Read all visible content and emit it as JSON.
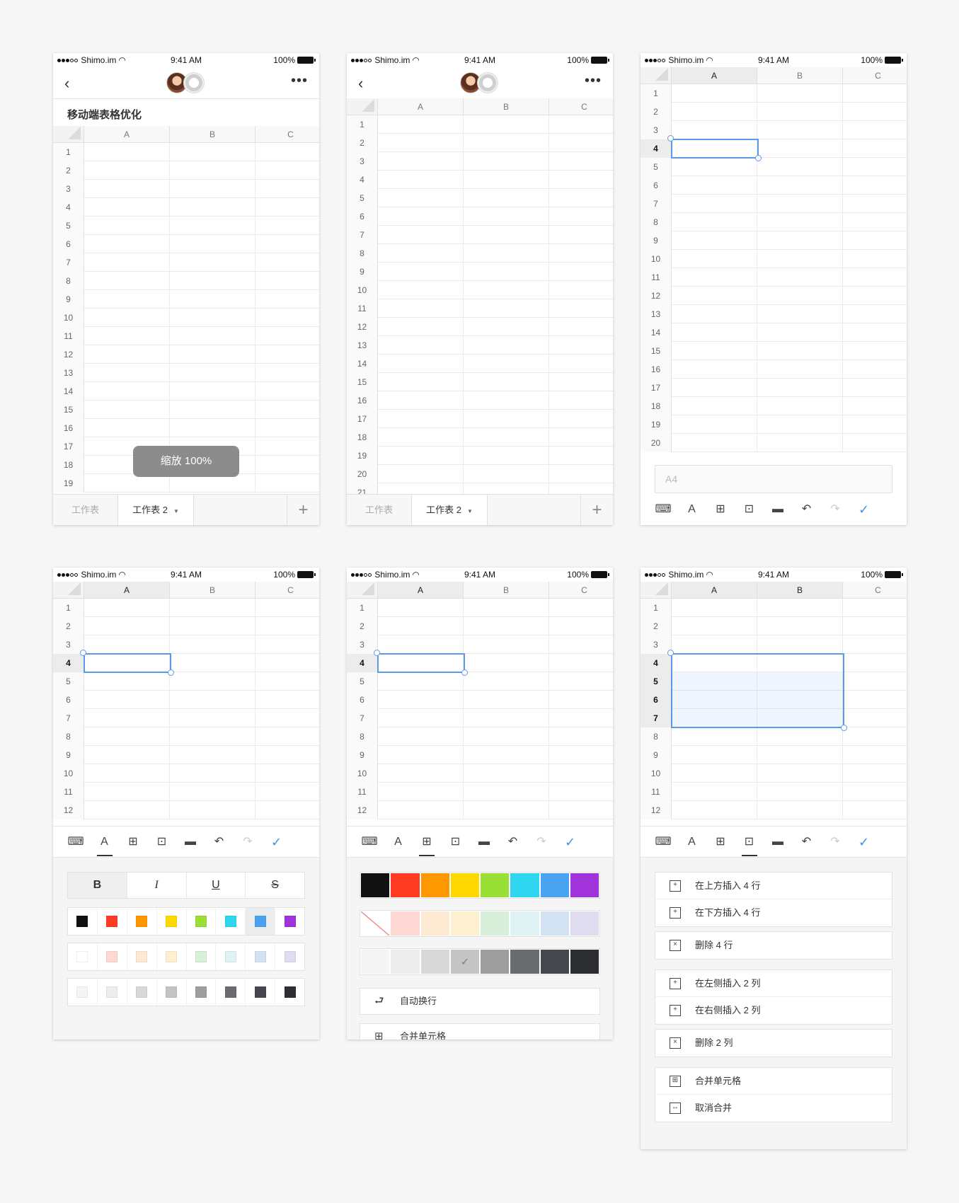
{
  "status": {
    "carrier": "Shimo.im",
    "time": "9:41 AM",
    "battery": "100%"
  },
  "columns": [
    "A",
    "B",
    "C"
  ],
  "doc_title": "移动端表格优化",
  "zoom_toast": "缩放 100%",
  "sheet_tabs": {
    "sheet1": "工作表",
    "sheet2": "工作表 2"
  },
  "formula_bar": {
    "cell_ref": "A4"
  },
  "text_format": {
    "bold": "B",
    "italic": "I",
    "underline": "U",
    "strike": "S"
  },
  "text_colors": [
    "#111111",
    "#ff3b24",
    "#ff9800",
    "#ffd800",
    "#9adf36",
    "#2ed6f0",
    "#4aa3f0",
    "#a033d9"
  ],
  "text_colors_light": [
    "#ffffff",
    "#fdd8d4",
    "#fde8d2",
    "#fdf0d1",
    "#d8efd9",
    "#dff2f4",
    "#d3e2f2",
    "#e0dcef"
  ],
  "text_colors_gray": [
    "#f5f5f5",
    "#ededed",
    "#d8d8d8",
    "#c4c4c4",
    "#9e9e9e",
    "#6a6b6e",
    "#44474c",
    "#2c2e31"
  ],
  "cell_options": {
    "wrap": "自动换行",
    "merge": "合并单元格"
  },
  "row_col_menu": {
    "insert_above": "在上方插入 4 行",
    "insert_below": "在下方插入 4 行",
    "delete_rows": "删除 4 行",
    "insert_left": "在左侧插入 2 列",
    "insert_right": "在右侧插入 2 列",
    "delete_cols": "删除 2 列",
    "merge": "合并单元格",
    "unmerge": "取消合并"
  },
  "toolbar_icons": [
    "keyboard-icon",
    "text-format-icon",
    "cell-format-icon",
    "row-column-icon",
    "comment-icon",
    "undo-icon",
    "redo-icon",
    "done-check-icon"
  ],
  "accent_color": "#5b9ae8"
}
